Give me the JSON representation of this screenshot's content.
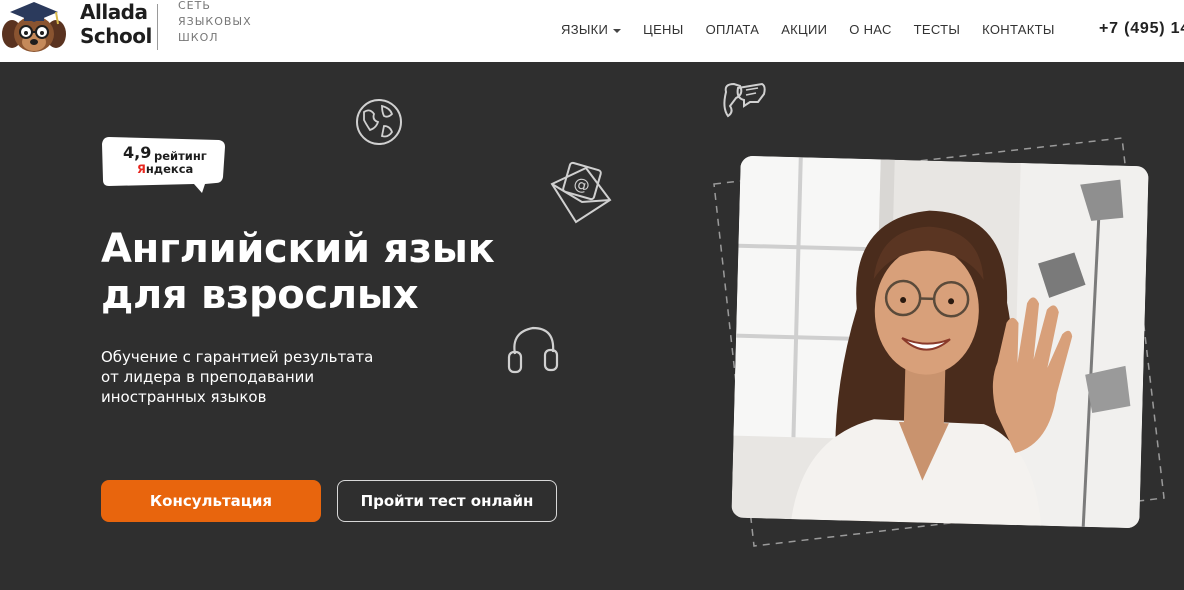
{
  "brand": {
    "name_line1": "Allada",
    "name_line2": "School",
    "tagline_line1": "СЕТЬ",
    "tagline_line2": "ЯЗЫКОВЫХ",
    "tagline_line3": "ШКОЛ"
  },
  "nav": {
    "items": [
      {
        "label": "ЯЗЫКИ",
        "has_dropdown": true
      },
      {
        "label": "ЦЕНЫ"
      },
      {
        "label": "ОПЛАТА"
      },
      {
        "label": "АКЦИИ"
      },
      {
        "label": "О НАС"
      },
      {
        "label": "ТЕСТЫ"
      },
      {
        "label": "КОНТАКТЫ"
      }
    ],
    "phone": "+7 (495) 14"
  },
  "rating": {
    "value": "4,9",
    "word": "рейтинг",
    "source_first_letter": "Я",
    "source_rest": "ндекса"
  },
  "hero": {
    "title_line1": "Английский язык",
    "title_line2": "для взрослых",
    "subtitle_line1": "Обучение с гарантией результата",
    "subtitle_line2": "от лидера в преподавании",
    "subtitle_line3": "иностранных языков",
    "primary_button": "Консультация",
    "secondary_button": "Пройти тест онлайн"
  },
  "icons": {
    "globe": "globe-icon",
    "chat": "chat-bubbles-icon",
    "mail": "mail-at-icon",
    "headphones": "headphones-icon",
    "mascot": "dog-mascot-icon"
  },
  "colors": {
    "background": "#2f2f2f",
    "header": "#ffffff",
    "accent": "#e8650d",
    "yandex_red": "#e8261e"
  }
}
